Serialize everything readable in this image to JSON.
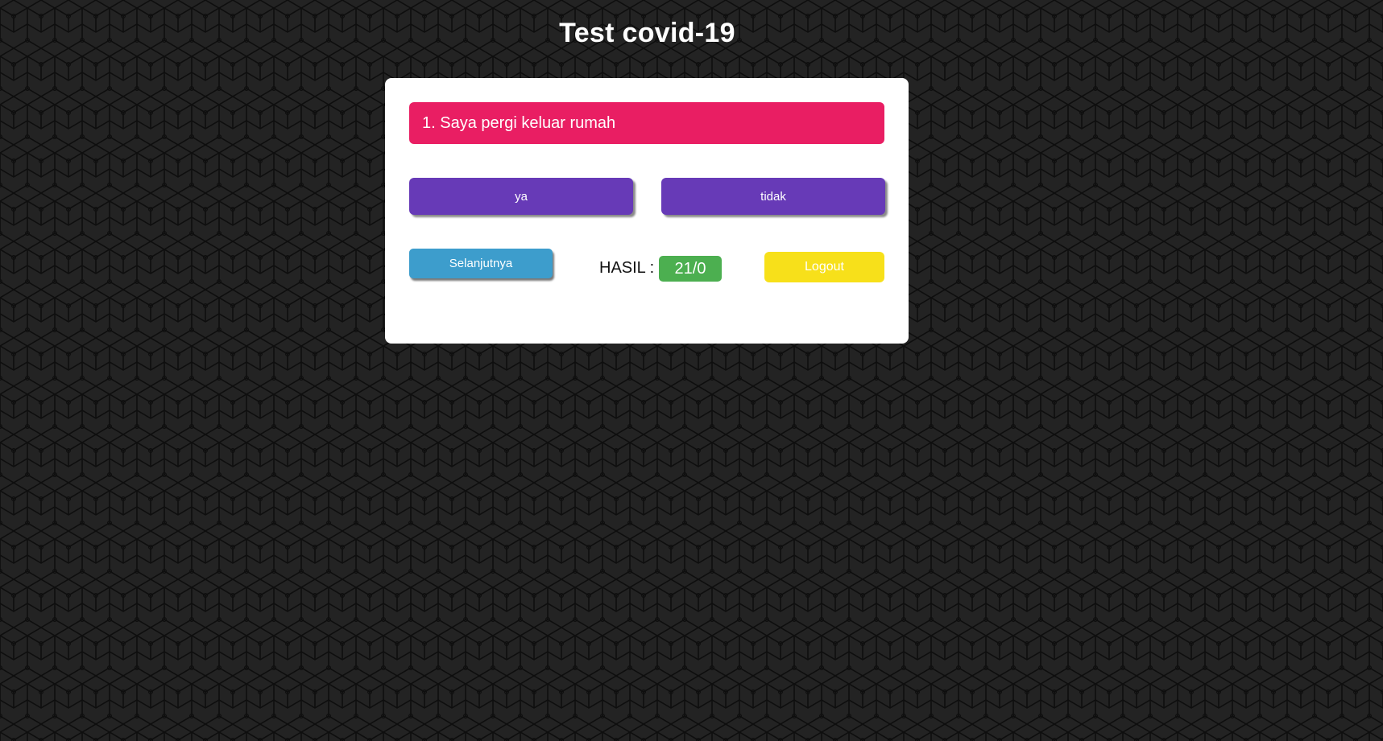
{
  "page": {
    "title": "Test covid-19"
  },
  "quiz": {
    "question": "1. Saya pergi keluar rumah",
    "answers": {
      "yes_label": "ya",
      "no_label": "tidak"
    },
    "next_label": "Selanjutnya",
    "result": {
      "label": "HASIL :",
      "value": "21/0"
    },
    "logout_label": "Logout"
  },
  "colors": {
    "background": "#232323",
    "pattern_line": "#0e0e0e",
    "question_bg": "#e91e63",
    "answer_bg": "#673ab7",
    "next_bg": "#3d9dcc",
    "result_badge_bg": "#4caf50",
    "logout_bg": "#f7e01a"
  }
}
